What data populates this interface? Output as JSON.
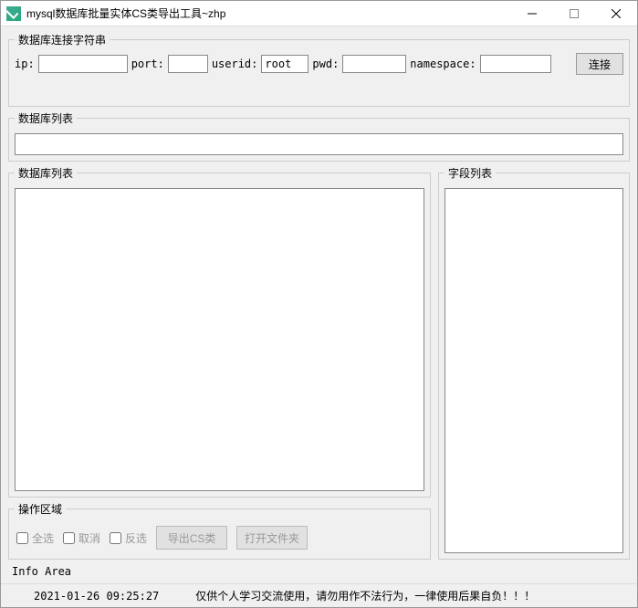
{
  "titlebar": {
    "title": "mysql数据库批量实体CS类导出工具~zhp"
  },
  "conn": {
    "legend": "数据库连接字符串",
    "ip_label": "ip:",
    "ip_value": "",
    "port_label": "port:",
    "port_value": "",
    "user_label": "userid:",
    "user_value": "root",
    "pwd_label": "pwd:",
    "pwd_value": "",
    "ns_label": "namespace:",
    "ns_value": "",
    "connect_label": "连接"
  },
  "db_list": {
    "legend": "数据库列表"
  },
  "table_list": {
    "legend": "数据库列表"
  },
  "field_list": {
    "legend": "字段列表"
  },
  "ops": {
    "legend": "操作区域",
    "select_all": "全选",
    "deselect": "取消",
    "invert": "反选",
    "export_label": "导出CS类",
    "open_folder_label": "打开文件夹"
  },
  "info": {
    "label": "Info Area"
  },
  "status": {
    "time": "2021-01-26 09:25:27",
    "message": "仅供个人学习交流使用，请勿用作不法行为，一律使用后果自负！！！"
  }
}
